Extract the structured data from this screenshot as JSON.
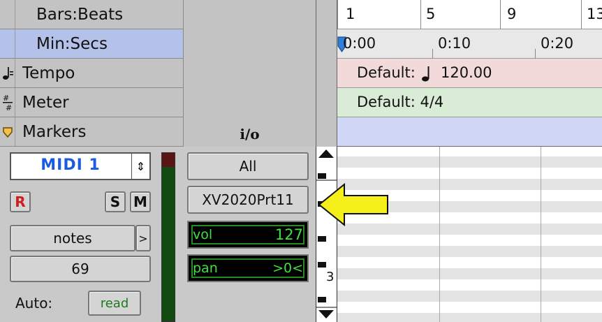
{
  "rulers": {
    "bars_beats": "Bars:Beats",
    "min_secs": "Min:Secs",
    "tempo": "Tempo",
    "meter": "Meter",
    "markers": "Markers"
  },
  "io_header": "i/o",
  "timeline": {
    "bars": [
      "1",
      "5",
      "9",
      "13"
    ],
    "times": [
      "0:00",
      "0:10",
      "0:20"
    ],
    "tempo_default": "Default:",
    "tempo_value": "120.00",
    "meter_default": "Default: 4/4"
  },
  "track": {
    "name": "MIDI 1",
    "record_label": "R",
    "solo_label": "S",
    "mute_label": "M",
    "view_label": "notes",
    "view_arrow": ">",
    "number": "69",
    "auto_label": "Auto:",
    "auto_value": "read",
    "input_label": "All",
    "output_label": "XV2020Prt11",
    "vol_label": "vol",
    "vol_value": "127",
    "pan_label": "pan",
    "pan_value": ">0<",
    "scroll_marker": "3"
  },
  "colors": {
    "min_secs_highlight": "#b4c2ea",
    "tempo_ruler": "#f2dada",
    "meter_ruler": "#d9ecd6",
    "markers_ruler": "#cfd7f5",
    "track_name": "#1a5be0",
    "record": "#d01e1e",
    "level_text": "#3fe03f",
    "arrow": "#f5ef1a"
  }
}
